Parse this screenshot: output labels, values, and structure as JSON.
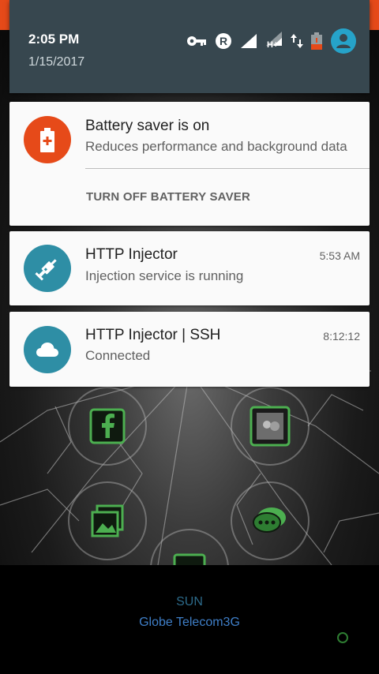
{
  "status_bar": {
    "time": "2:05 PM",
    "date": "1/15/2017",
    "icons": [
      "vpn-key-icon",
      "roaming-r-icon",
      "signal-icon",
      "signal-h-plus-icon",
      "data-arrows-icon",
      "battery-low-icon",
      "user-avatar-icon"
    ],
    "network_label": "H+"
  },
  "notifications": [
    {
      "title": "Battery saver is on",
      "text": "Reduces performance and background data",
      "action": "TURN OFF BATTERY SAVER",
      "icon": "battery-plus-icon",
      "color": "#e64a19"
    },
    {
      "title": "HTTP Injector",
      "text": "Injection service is running",
      "time": "5:53 AM",
      "icon": "syringe-icon",
      "color": "#2e8ea5"
    },
    {
      "title": "HTTP Injector | SSH",
      "text": "Connected",
      "time": "8:12:12",
      "icon": "cloud-icon",
      "color": "#2e8ea5"
    }
  ],
  "home_screen": {
    "carrier_primary": "SUN",
    "carrier_secondary": "Globe Telecom3G",
    "app_icons": [
      "facebook-icon",
      "game-app-icon",
      "gallery-icon",
      "messaging-icon",
      "photos-icon"
    ]
  },
  "colors": {
    "header_bg": "#37474f",
    "accent_orange": "#e64a19",
    "injector_teal": "#2e8ea5",
    "icon_green": "#4caf50"
  }
}
